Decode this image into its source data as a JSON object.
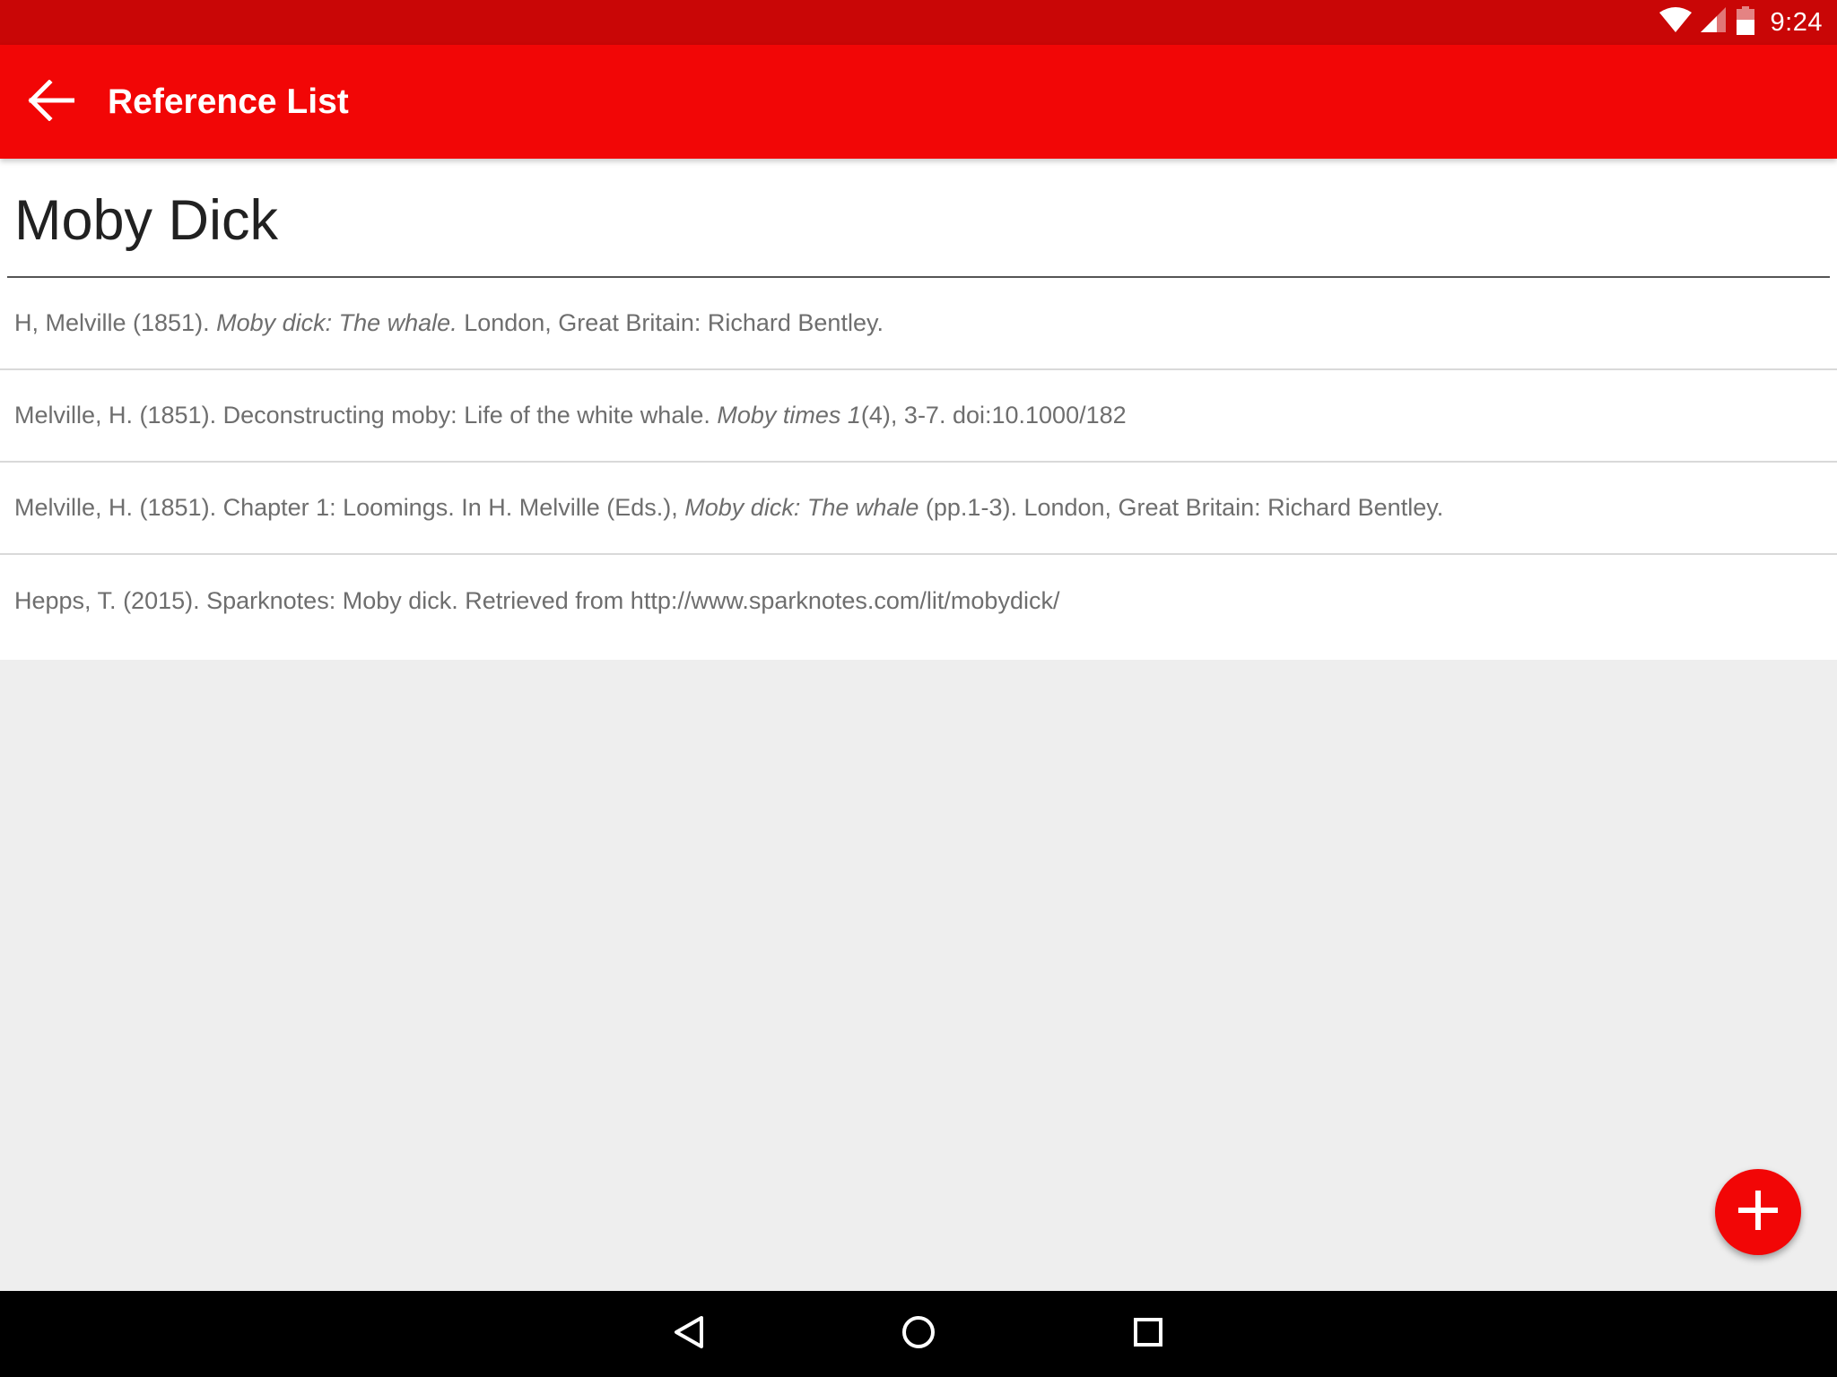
{
  "status_bar": {
    "time": "9:24",
    "icons": [
      "wifi-icon",
      "cellular-signal-icon",
      "battery-icon"
    ]
  },
  "app_bar": {
    "title": "Reference List",
    "back_icon": "arrow-back-icon",
    "background_color": "#f20606"
  },
  "list_title": "Moby Dick",
  "references": [
    {
      "parts": [
        {
          "text": "H, Melville (1851). ",
          "italic": false
        },
        {
          "text": "Moby dick: The whale.",
          "italic": true
        },
        {
          "text": " London, Great Britain: Richard Bentley.",
          "italic": false
        }
      ]
    },
    {
      "parts": [
        {
          "text": "Melville, H. (1851). Deconstructing moby: Life of the white whale. ",
          "italic": false
        },
        {
          "text": "Moby times 1",
          "italic": true
        },
        {
          "text": "(4), 3-7. doi:10.1000/182",
          "italic": false
        }
      ]
    },
    {
      "parts": [
        {
          "text": "Melville, H. (1851). Chapter 1: Loomings. In H. Melville (Eds.), ",
          "italic": false
        },
        {
          "text": "Moby dick: The whale",
          "italic": true
        },
        {
          "text": " (pp.1-3). London, Great Britain: Richard Bentley.",
          "italic": false
        }
      ]
    },
    {
      "parts": [
        {
          "text": "Hepps, T. (2015). Sparknotes: Moby dick. Retrieved from http://www.sparknotes.com/lit/mobydick/",
          "italic": false
        }
      ]
    }
  ],
  "fab": {
    "icon": "plus-icon",
    "color": "#f20606"
  },
  "nav_bar": {
    "icons": [
      "nav-back-icon",
      "home-icon",
      "recents-icon"
    ]
  }
}
